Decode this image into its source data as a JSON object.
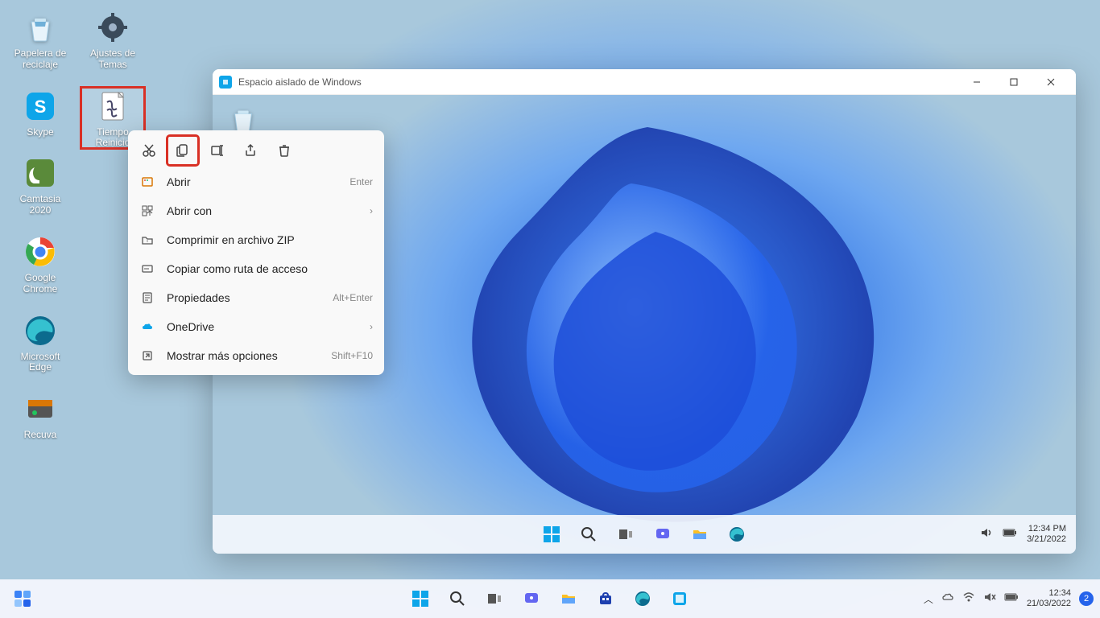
{
  "desktop": {
    "icons": [
      {
        "name": "Papelera de reciclaje"
      },
      {
        "name": "Skype"
      },
      {
        "name": "Camtasia 2020"
      },
      {
        "name": "Google Chrome"
      },
      {
        "name": "Microsoft Edge"
      },
      {
        "name": "Recuva"
      },
      {
        "name": "Ajustes de Temas"
      },
      {
        "name": "Tiempo Reinicio"
      }
    ]
  },
  "sandbox_window": {
    "title": "Espacio aislado de Windows",
    "inner_taskbar_time": "12:34 PM",
    "inner_taskbar_date": "3/21/2022"
  },
  "context_menu": {
    "items": [
      {
        "label": "Abrir",
        "accel": "Enter"
      },
      {
        "label": "Abrir con",
        "submenu": true
      },
      {
        "label": "Comprimir en archivo ZIP"
      },
      {
        "label": "Copiar como ruta de acceso"
      },
      {
        "label": "Propiedades",
        "accel": "Alt+Enter"
      },
      {
        "label": "OneDrive",
        "submenu": true
      },
      {
        "label": "Mostrar más opciones",
        "accel": "Shift+F10"
      }
    ]
  },
  "host_taskbar": {
    "time": "12:34",
    "date": "21/03/2022",
    "notif_count": "2"
  }
}
